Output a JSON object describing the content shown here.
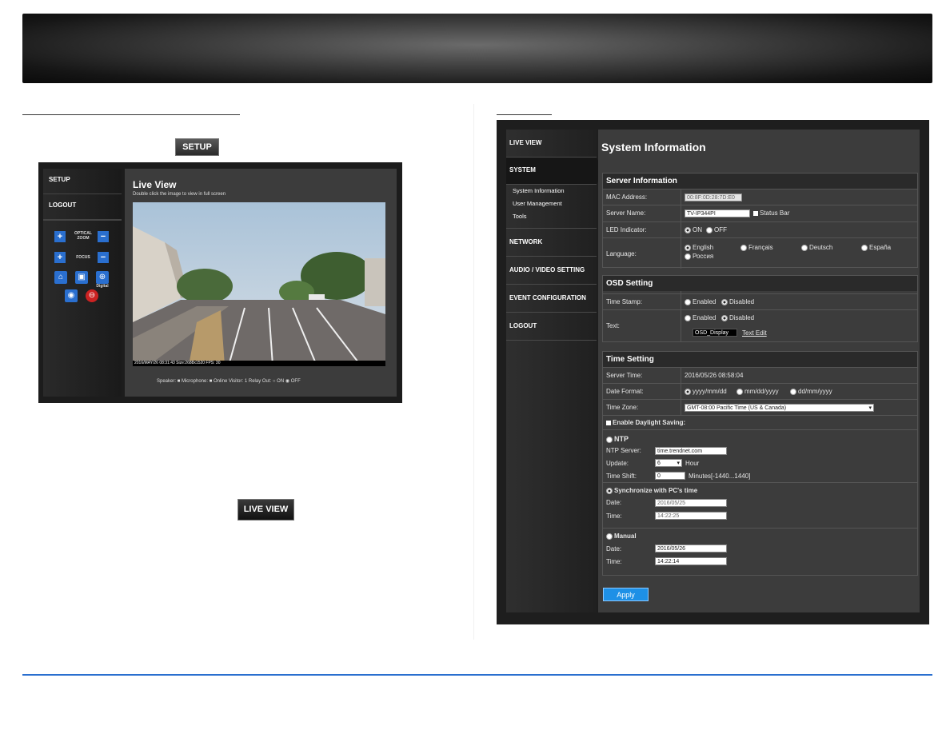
{
  "buttons": {
    "setup": "SETUP",
    "live_view": "LIVE VIEW"
  },
  "live_view": {
    "sidebar": [
      "SETUP",
      "LOGOUT"
    ],
    "optical_zoom": "OPTICAL ZOOM",
    "focus": "FOCUS",
    "digital": "Digital",
    "title": "Live View",
    "subtitle": "Double click the image to view in full screen",
    "overlay": "2016/MAY/26 08:31:43 Size:2688x1520 FPS: 30",
    "status": "Speaker: ■ Microphone: ■ Online Visitor: 1 Relay Out: ○ ON ◉ OFF"
  },
  "system_info": {
    "nav": [
      "LIVE VIEW",
      "SYSTEM",
      "NETWORK",
      "AUDIO / VIDEO SETTING",
      "EVENT CONFIGURATION",
      "LOGOUT"
    ],
    "subnav": [
      "System Information",
      "User Management",
      "Tools"
    ],
    "title": "System Information",
    "server": {
      "heading": "Server Information",
      "mac_label": "MAC Address:",
      "mac": "00:8F:0D:28:7D:E0",
      "name_label": "Server Name:",
      "name": "TV-IP344PI",
      "status_bar": "Status Bar",
      "led_label": "LED Indicator:",
      "led_on": "ON",
      "led_off": "OFF",
      "lang_label": "Language:",
      "langs": [
        "English",
        "Français",
        "Deutsch",
        "España",
        "Россия"
      ]
    },
    "osd": {
      "heading": "OSD Setting",
      "ts_label": "Time Stamp:",
      "enabled": "Enabled",
      "disabled": "Disabled",
      "text_label": "Text:",
      "text_value": "OSD_Display",
      "text_edit": "Text Edit"
    },
    "time": {
      "heading": "Time Setting",
      "server_time_label": "Server Time:",
      "server_time": "2016/05/26 08:58:04",
      "date_format_label": "Date Format:",
      "formats": [
        "yyyy/mm/dd",
        "mm/dd/yyyy",
        "dd/mm/yyyy"
      ],
      "tz_label": "Time Zone:",
      "tz": "GMT-08:00 Pacific Time (US & Canada)",
      "dst": "Enable Daylight Saving:",
      "ntp": "NTP",
      "ntp_server_label": "NTP Server:",
      "ntp_server": "time.trendnet.com",
      "update_label": "Update:",
      "update": "6",
      "hour": "Hour",
      "shift_label": "Time Shift:",
      "shift": "0",
      "minutes": "Minutes[-1440...1440]",
      "sync": "Synchronize with PC's time",
      "date_label": "Date:",
      "time_label": "Time:",
      "sync_date": "2016/05/25",
      "sync_time": "14:22:25",
      "manual": "Manual",
      "manual_date": "2016/05/26",
      "manual_time": "14:22:14"
    },
    "apply": "Apply"
  }
}
